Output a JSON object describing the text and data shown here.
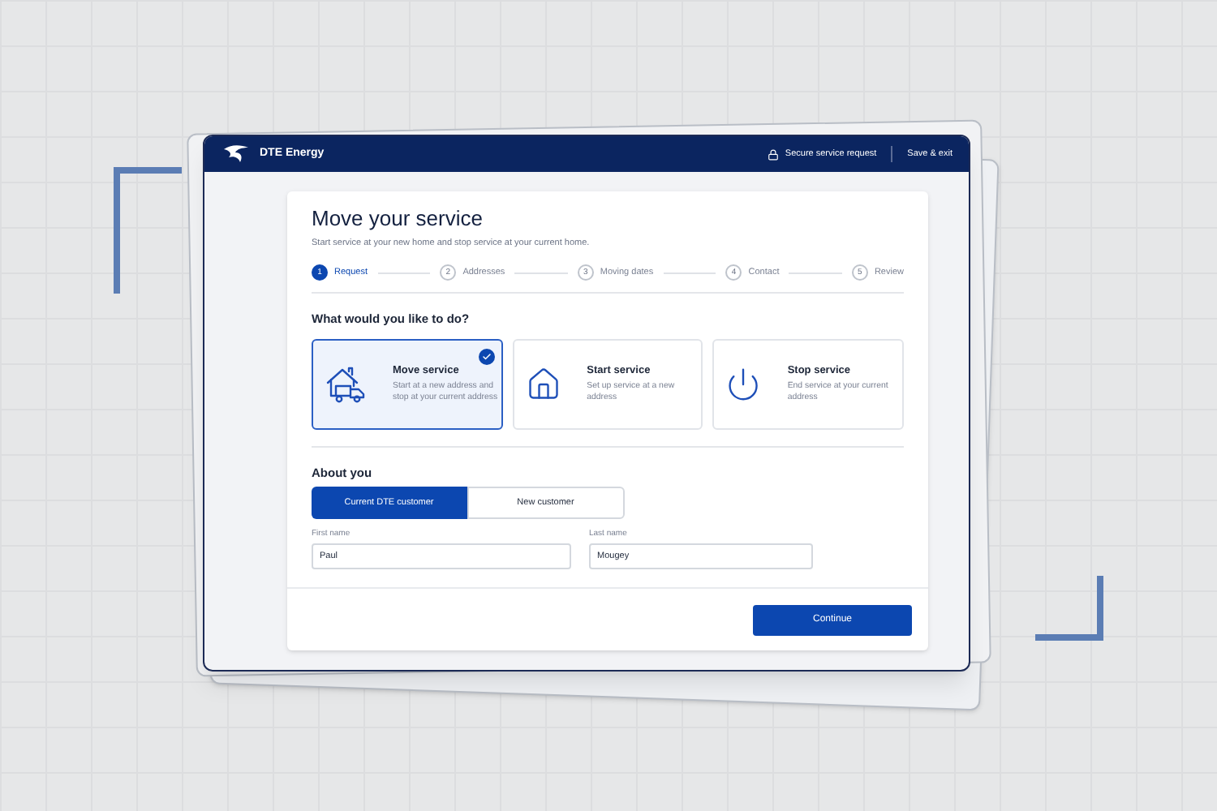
{
  "header": {
    "brand": "DTE Energy",
    "secure_label": "Secure service request",
    "save_exit": "Save & exit"
  },
  "page": {
    "title": "Move your service",
    "subtitle": "Start service at your new home and stop service at your current home."
  },
  "steps": [
    {
      "number": "1",
      "label": "Request",
      "selected": true
    },
    {
      "number": "2",
      "label": "Addresses",
      "selected": false
    },
    {
      "number": "3",
      "label": "Moving dates",
      "selected": false
    },
    {
      "number": "4",
      "label": "Contact",
      "selected": false
    },
    {
      "number": "5",
      "label": "Review",
      "selected": false
    }
  ],
  "question": "What would you like to do?",
  "options": [
    {
      "kind": "move",
      "title": "Move service",
      "description": "Start at a new address and stop at your current address",
      "selected": true
    },
    {
      "kind": "start",
      "title": "Start service",
      "description": "Set up service at a new address",
      "selected": false
    },
    {
      "kind": "stop",
      "title": "Stop service",
      "description": "End service at your current address",
      "selected": false
    }
  ],
  "about": {
    "heading": "About you",
    "customer_types": [
      {
        "label": "Current DTE customer",
        "selected": true
      },
      {
        "label": "New customer",
        "selected": false
      }
    ]
  },
  "fields": [
    {
      "label": "First name",
      "value": "Paul"
    },
    {
      "label": "Last name",
      "value": "Mougey"
    }
  ],
  "continue_button": "Continue"
}
